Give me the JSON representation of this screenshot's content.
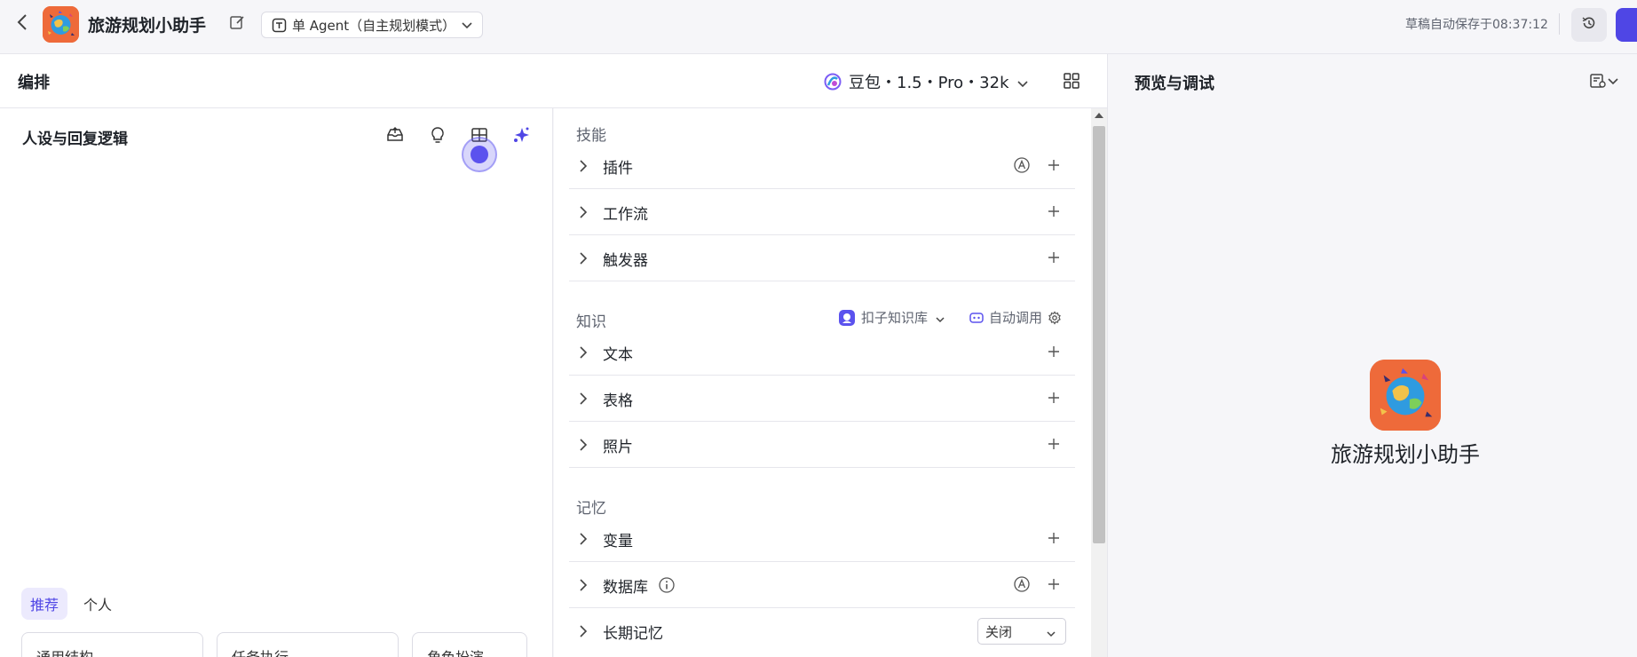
{
  "topbar": {
    "bot_name": "旅游规划小助手",
    "mode_label": "单 Agent（自主规划模式）",
    "save_status": "草稿自动保存于08:37:12"
  },
  "compose": {
    "title": "编排",
    "model_label": "豆包・1.5・Pro・32k"
  },
  "persona": {
    "title": "人设与回复逻辑",
    "tabs": [
      {
        "label": "推荐",
        "active": true
      },
      {
        "label": "个人",
        "active": false
      }
    ],
    "templates": [
      "通用结构",
      "任务执行",
      "角色扮演"
    ]
  },
  "skills": {
    "section_skill": "技能",
    "skill_rows": [
      "插件",
      "工作流",
      "触发器"
    ],
    "section_knowledge": "知识",
    "kb_source": "扣子知识库",
    "auto_call": "自动调用",
    "knowledge_rows": [
      "文本",
      "表格",
      "照片"
    ],
    "section_memory": "记忆",
    "memory_rows": [
      "变量",
      "数据库",
      "长期记忆"
    ],
    "long_term_memory_value": "关闭"
  },
  "preview": {
    "title": "预览与调试",
    "bot_name": "旅游规划小助手"
  },
  "colors": {
    "accent": "#4f46e5",
    "avatar_bg": "#ee6a3a"
  }
}
